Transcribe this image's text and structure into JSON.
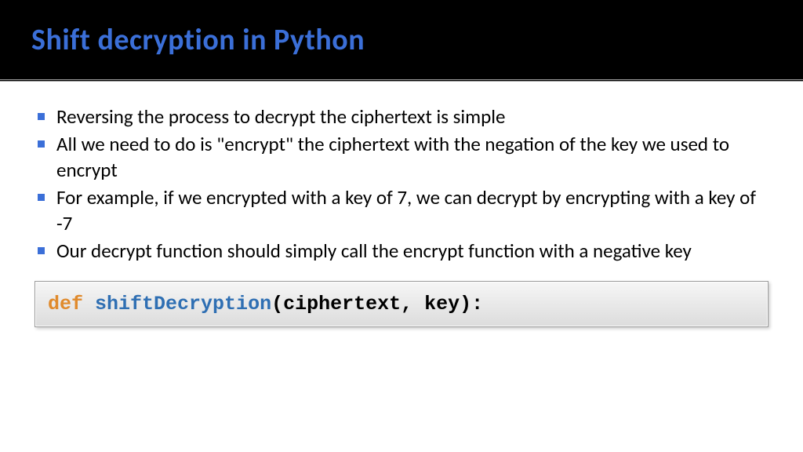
{
  "header": {
    "title": "Shift decryption in Python"
  },
  "bullets": [
    "Reversing the process to decrypt the ciphertext is simple",
    "All we need to do is \"encrypt\" the ciphertext with the negation of the key we used to encrypt",
    "For example, if we encrypted with a key of 7, we can decrypt by encrypting with a key of -7",
    "Our decrypt function should simply call the encrypt function with a negative key"
  ],
  "code": {
    "keyword": "def",
    "space1": " ",
    "func": "shiftDecryption",
    "params": "(ciphertext, key):"
  }
}
